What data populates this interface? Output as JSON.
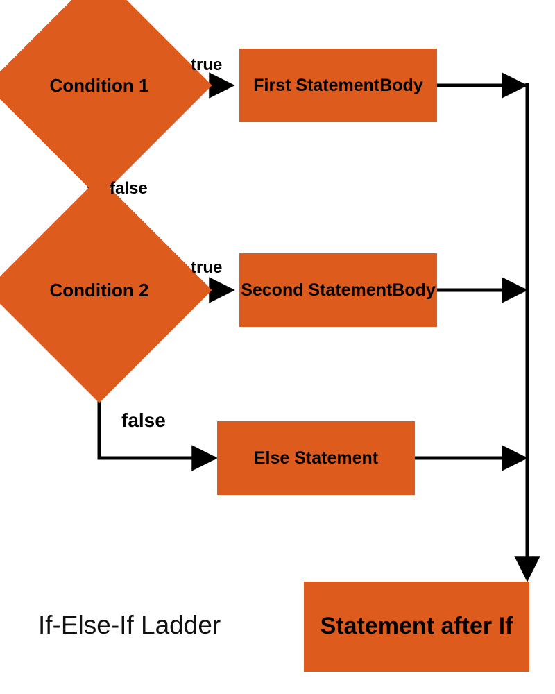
{
  "title": "If-Else-If Ladder",
  "colors": {
    "node": "#de5b1e",
    "text": "#000000",
    "edge": "#000000"
  },
  "nodes": {
    "cond1": {
      "label": "Condition 1"
    },
    "cond2": {
      "label": "Condition 2"
    },
    "body1": {
      "label": "First StatementBody"
    },
    "body2": {
      "label": "Second StatementBody"
    },
    "elseBody": {
      "label": "Else Statement"
    },
    "after": {
      "label": "Statement after If"
    }
  },
  "edge_labels": {
    "cond1_true": "true",
    "cond1_false": "false",
    "cond2_true": "true",
    "cond2_false": "false"
  }
}
